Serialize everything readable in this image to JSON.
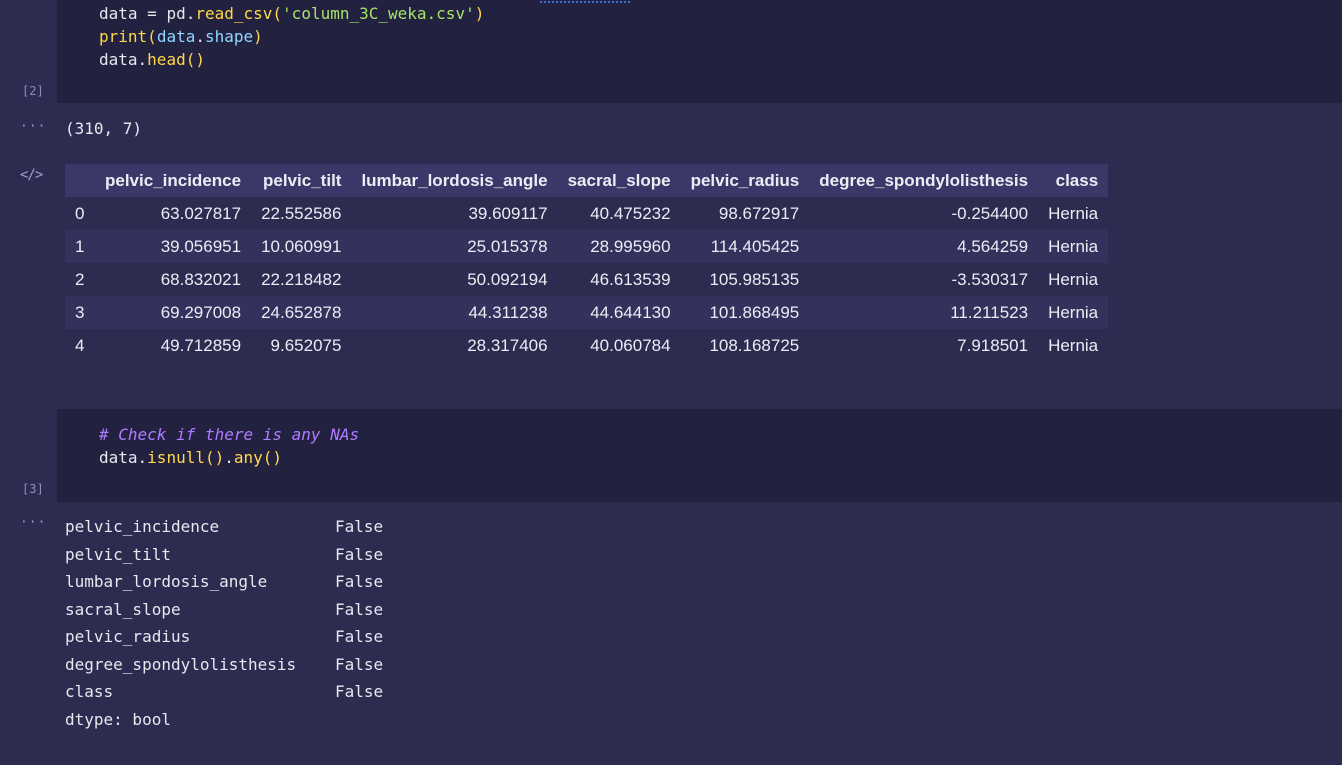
{
  "cells": [
    {
      "exec_count": "[2]",
      "code_lines": [
        [
          {
            "t": "data",
            "c": "plain"
          },
          {
            "t": " = ",
            "c": "plain"
          },
          {
            "t": "pd",
            "c": "plain"
          },
          {
            "t": ".",
            "c": "plain"
          },
          {
            "t": "read_csv",
            "c": "fn"
          },
          {
            "t": "(",
            "c": "fn"
          },
          {
            "t": "'column_3C_weka.csv'",
            "c": "str"
          },
          {
            "t": ")",
            "c": "fn"
          }
        ],
        [
          {
            "t": "print",
            "c": "fn"
          },
          {
            "t": "(",
            "c": "fn"
          },
          {
            "t": "data",
            "c": "attr"
          },
          {
            "t": ".",
            "c": "plain"
          },
          {
            "t": "shape",
            "c": "attr"
          },
          {
            "t": ")",
            "c": "fn"
          }
        ],
        [
          {
            "t": "data",
            "c": "plain"
          },
          {
            "t": ".",
            "c": "plain"
          },
          {
            "t": "head",
            "c": "fn"
          },
          {
            "t": "()",
            "c": "fn"
          }
        ]
      ],
      "output_text": "(310, 7)",
      "output_icon": "···",
      "html_output_icon": "</>",
      "table": {
        "columns": [
          "",
          "pelvic_incidence",
          "pelvic_tilt",
          "lumbar_lordosis_angle",
          "sacral_slope",
          "pelvic_radius",
          "degree_spondylolisthesis",
          "class"
        ],
        "rows": [
          [
            "0",
            "63.027817",
            "22.552586",
            "39.609117",
            "40.475232",
            "98.672917",
            "-0.254400",
            "Hernia"
          ],
          [
            "1",
            "39.056951",
            "10.060991",
            "25.015378",
            "28.995960",
            "114.405425",
            "4.564259",
            "Hernia"
          ],
          [
            "2",
            "68.832021",
            "22.218482",
            "50.092194",
            "46.613539",
            "105.985135",
            "-3.530317",
            "Hernia"
          ],
          [
            "3",
            "69.297008",
            "24.652878",
            "44.311238",
            "44.644130",
            "101.868495",
            "11.211523",
            "Hernia"
          ],
          [
            "4",
            "49.712859",
            "9.652075",
            "28.317406",
            "40.060784",
            "108.168725",
            "7.918501",
            "Hernia"
          ]
        ]
      }
    },
    {
      "exec_count": "[3]",
      "code_lines": [
        [
          {
            "t": "# Check if there is any NAs",
            "c": "comment"
          }
        ],
        [
          {
            "t": "data",
            "c": "plain"
          },
          {
            "t": ".",
            "c": "plain"
          },
          {
            "t": "isnull",
            "c": "fn"
          },
          {
            "t": "()",
            "c": "fn"
          },
          {
            "t": ".",
            "c": "plain"
          },
          {
            "t": "any",
            "c": "fn"
          },
          {
            "t": "()",
            "c": "fn"
          }
        ]
      ],
      "output_icon": "···",
      "series": [
        {
          "key": "pelvic_incidence",
          "value": "False"
        },
        {
          "key": "pelvic_tilt",
          "value": "False"
        },
        {
          "key": "lumbar_lordosis_angle",
          "value": "False"
        },
        {
          "key": "sacral_slope",
          "value": "False"
        },
        {
          "key": "pelvic_radius",
          "value": "False"
        },
        {
          "key": "degree_spondylolisthesis",
          "value": "False"
        },
        {
          "key": "class",
          "value": "False"
        }
      ],
      "dtype": "dtype: bool"
    }
  ],
  "colors": {
    "background": "#2d2b50",
    "code_cell": "#222140",
    "function": "#ffd84a",
    "string": "#a6e36a",
    "attribute": "#8fd8ff",
    "comment": "#b07cff"
  }
}
